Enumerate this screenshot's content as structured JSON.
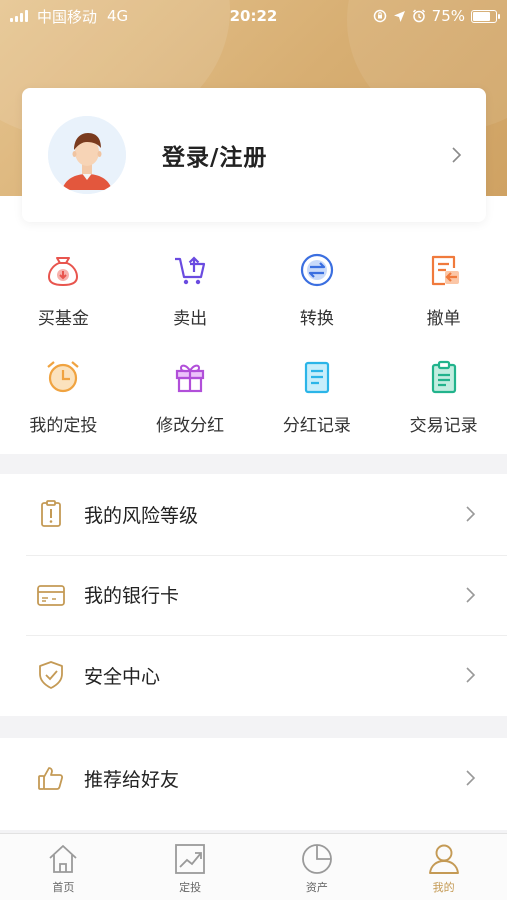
{
  "status_bar": {
    "carrier": "中国移动",
    "network": "4G",
    "time": "20:22",
    "battery": "75%",
    "battery_level": 0.75
  },
  "profile": {
    "login_label": "登录/注册"
  },
  "quick_actions": [
    {
      "label": "买基金",
      "icon": "buy-fund-icon",
      "color": "#e8554e"
    },
    {
      "label": "卖出",
      "icon": "sell-cart-icon",
      "color": "#6a4be0"
    },
    {
      "label": "转换",
      "icon": "convert-icon",
      "color": "#3b6fe0"
    },
    {
      "label": "撤单",
      "icon": "cancel-order-icon",
      "color": "#f07a3c"
    },
    {
      "label": "我的定投",
      "icon": "alarm-clock-icon",
      "color": "#f0a340"
    },
    {
      "label": "修改分红",
      "icon": "gift-icon",
      "color": "#b14fd9"
    },
    {
      "label": "分红记录",
      "icon": "record-icon",
      "color": "#2bb5e8"
    },
    {
      "label": "交易记录",
      "icon": "clipboard-icon",
      "color": "#22b38c"
    }
  ],
  "menu": {
    "items": [
      {
        "label": "我的风险等级",
        "icon": "risk-level-icon"
      },
      {
        "label": "我的银行卡",
        "icon": "bank-card-icon"
      },
      {
        "label": "安全中心",
        "icon": "shield-check-icon"
      }
    ],
    "recommend": {
      "label": "推荐给好友",
      "icon": "thumbs-up-icon"
    }
  },
  "tabbar": [
    {
      "label": "首页",
      "icon": "home-icon"
    },
    {
      "label": "定投",
      "icon": "chart-trend-icon"
    },
    {
      "label": "资产",
      "icon": "pie-chart-icon"
    },
    {
      "label": "我的",
      "icon": "user-icon",
      "active": true
    }
  ],
  "colors": {
    "accent": "#c49a55",
    "header_gradient_start": "#e6c48f",
    "header_gradient_end": "#cfa263"
  }
}
